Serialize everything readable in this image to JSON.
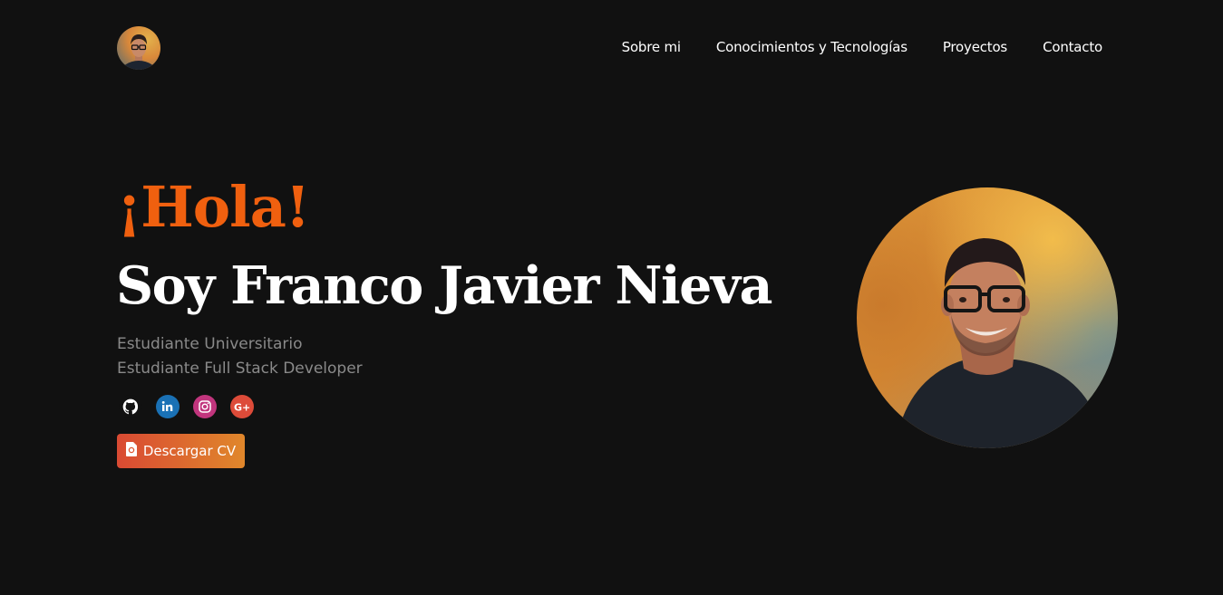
{
  "header": {
    "nav": [
      {
        "label": "Sobre mi"
      },
      {
        "label": "Conocimientos y Tecnologías"
      },
      {
        "label": "Proyectos"
      },
      {
        "label": "Contacto"
      }
    ]
  },
  "hero": {
    "greeting": "¡Hola!",
    "name": "Soy Franco Javier Nieva",
    "roles": [
      "Estudiante Universitario",
      "Estudiante Full Stack Developer"
    ],
    "socials": [
      {
        "icon": "github-icon",
        "color": "#ffffff"
      },
      {
        "icon": "linkedin-icon",
        "color": "#0a66c2"
      },
      {
        "icon": "instagram-icon",
        "color": "#c13584"
      },
      {
        "icon": "google-plus-icon",
        "color": "#dd4b39"
      }
    ],
    "cv_button": {
      "label": "Descargar CV",
      "icon": "file-pdf-icon"
    }
  },
  "colors": {
    "background": "#111111",
    "accent": "#f0600f",
    "text": "#ffffff",
    "muted": "#8a8a8a"
  }
}
